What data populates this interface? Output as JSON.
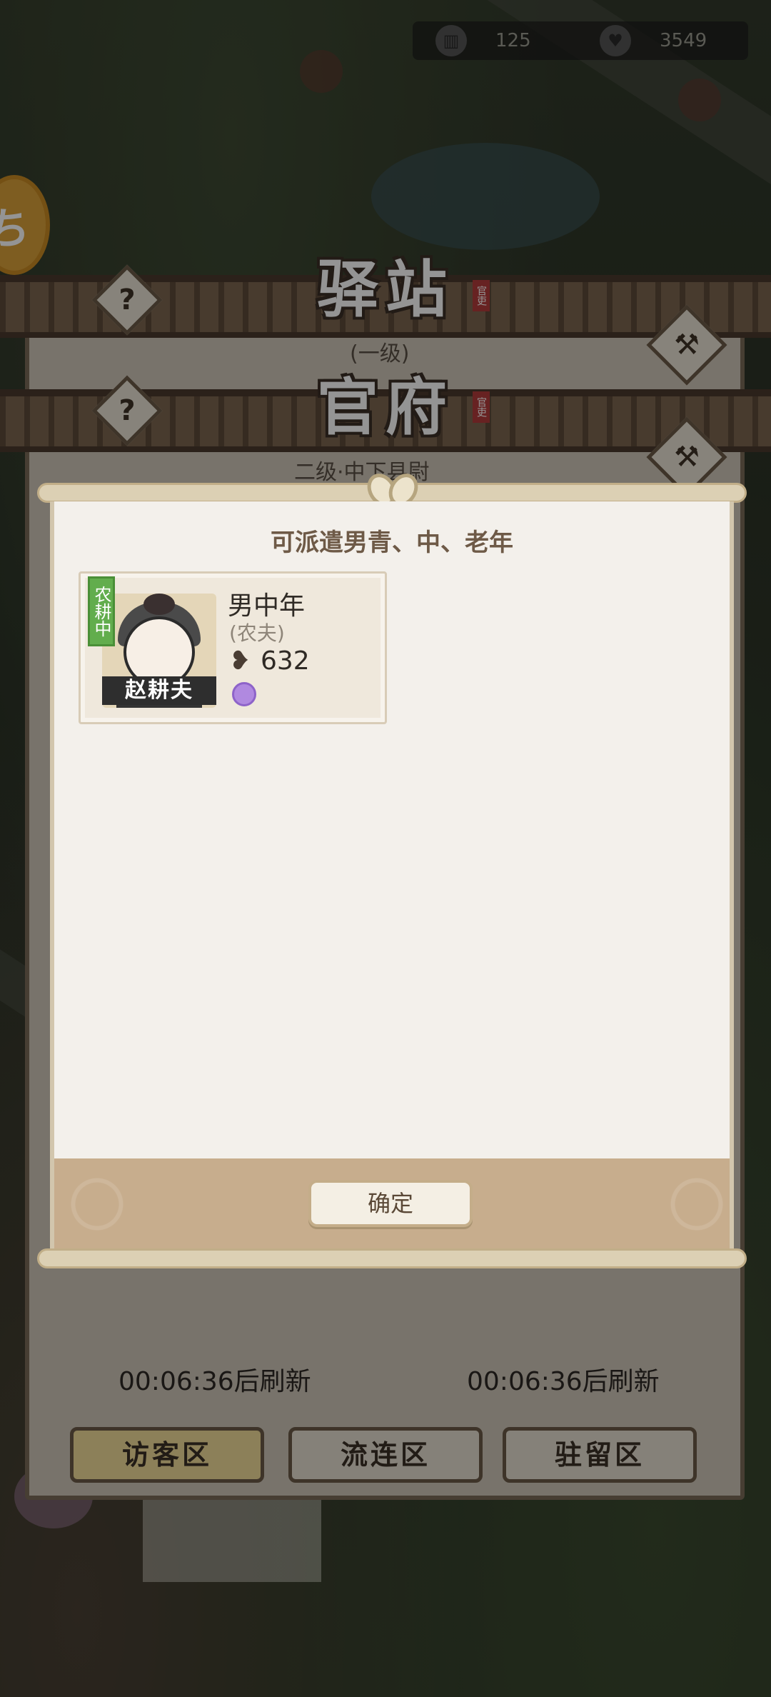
{
  "top_bar": {
    "resources": [
      {
        "icon": "building-icon",
        "value": "125"
      },
      {
        "icon": "heart-icon",
        "value": "3549"
      }
    ]
  },
  "side_button": {
    "icon": "event-icon"
  },
  "background_panel": {
    "building1": {
      "title": "驿站",
      "subtitle": "(一级)",
      "stamp": "官吏"
    },
    "building2": {
      "title": "官府",
      "subtitle": "二级·中下县尉",
      "stamp": "官吏"
    },
    "refresh_left": "00:06:36后刷新",
    "refresh_right": "00:06:36后刷新",
    "tabs": [
      {
        "label": "访客区",
        "active": true
      },
      {
        "label": "流连区",
        "active": false
      },
      {
        "label": "驻留区",
        "active": false
      }
    ]
  },
  "popup": {
    "title": "可派遣男青、中、老年",
    "cards": [
      {
        "status": "农耕中",
        "name": "赵耕夫",
        "type": "男中年",
        "job": "(农夫)",
        "power": "632"
      }
    ],
    "confirm_label": "确定"
  },
  "colors": {
    "status_green": "#62ad4d",
    "popup_bg": "#f3f0eb",
    "footer_tan": "#c7ad8d",
    "active_tab": "#f2dd9a"
  }
}
